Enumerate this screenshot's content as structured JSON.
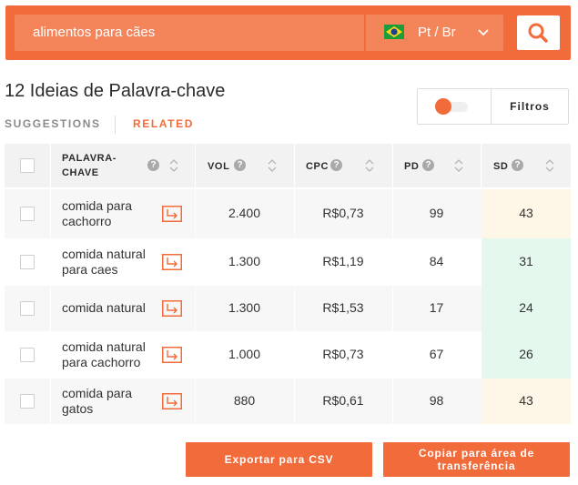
{
  "search": {
    "query": "alimentos para cães",
    "language_label": "Pt / Br",
    "flag_icon": "brazil-flag-icon",
    "accent_color": "#f26b3a"
  },
  "results": {
    "title": "12 Ideias de Palavra-chave",
    "filters_label": "Filtros",
    "tabs": [
      {
        "label": "SUGGESTIONS",
        "active": false
      },
      {
        "label": "RELATED",
        "active": true
      }
    ]
  },
  "table": {
    "headers": {
      "keyword_line1": "PALAVRA-",
      "keyword_line2": "CHAVE",
      "vol": "VOL",
      "cpc": "CPC",
      "pd": "PD",
      "sd": "SD"
    },
    "help_glyph": "?",
    "rows": [
      {
        "kw1": "comida para",
        "kw2": "cachorro",
        "vol": "2.400",
        "cpc": "R$0,73",
        "pd": "99",
        "sd": "43",
        "sd_color": "#fef7e8"
      },
      {
        "kw1": "comida natural",
        "kw2": "para caes",
        "vol": "1.300",
        "cpc": "R$1,19",
        "pd": "84",
        "sd": "31",
        "sd_color": "#e4f8ee"
      },
      {
        "kw1": "comida natural",
        "kw2": "",
        "vol": "1.300",
        "cpc": "R$1,53",
        "pd": "17",
        "sd": "24",
        "sd_color": "#e4f8ee"
      },
      {
        "kw1": "comida natural",
        "kw2": "para cachorro",
        "vol": "1.000",
        "cpc": "R$0,73",
        "pd": "67",
        "sd": "26",
        "sd_color": "#e4f8ee"
      },
      {
        "kw1": "comida para",
        "kw2": "gatos",
        "vol": "880",
        "cpc": "R$0,61",
        "pd": "98",
        "sd": "43",
        "sd_color": "#fef7e8"
      }
    ]
  },
  "actions": {
    "export_label": "Exportar para CSV",
    "copy_line1": "Copiar para área de",
    "copy_line2": "transferência"
  }
}
